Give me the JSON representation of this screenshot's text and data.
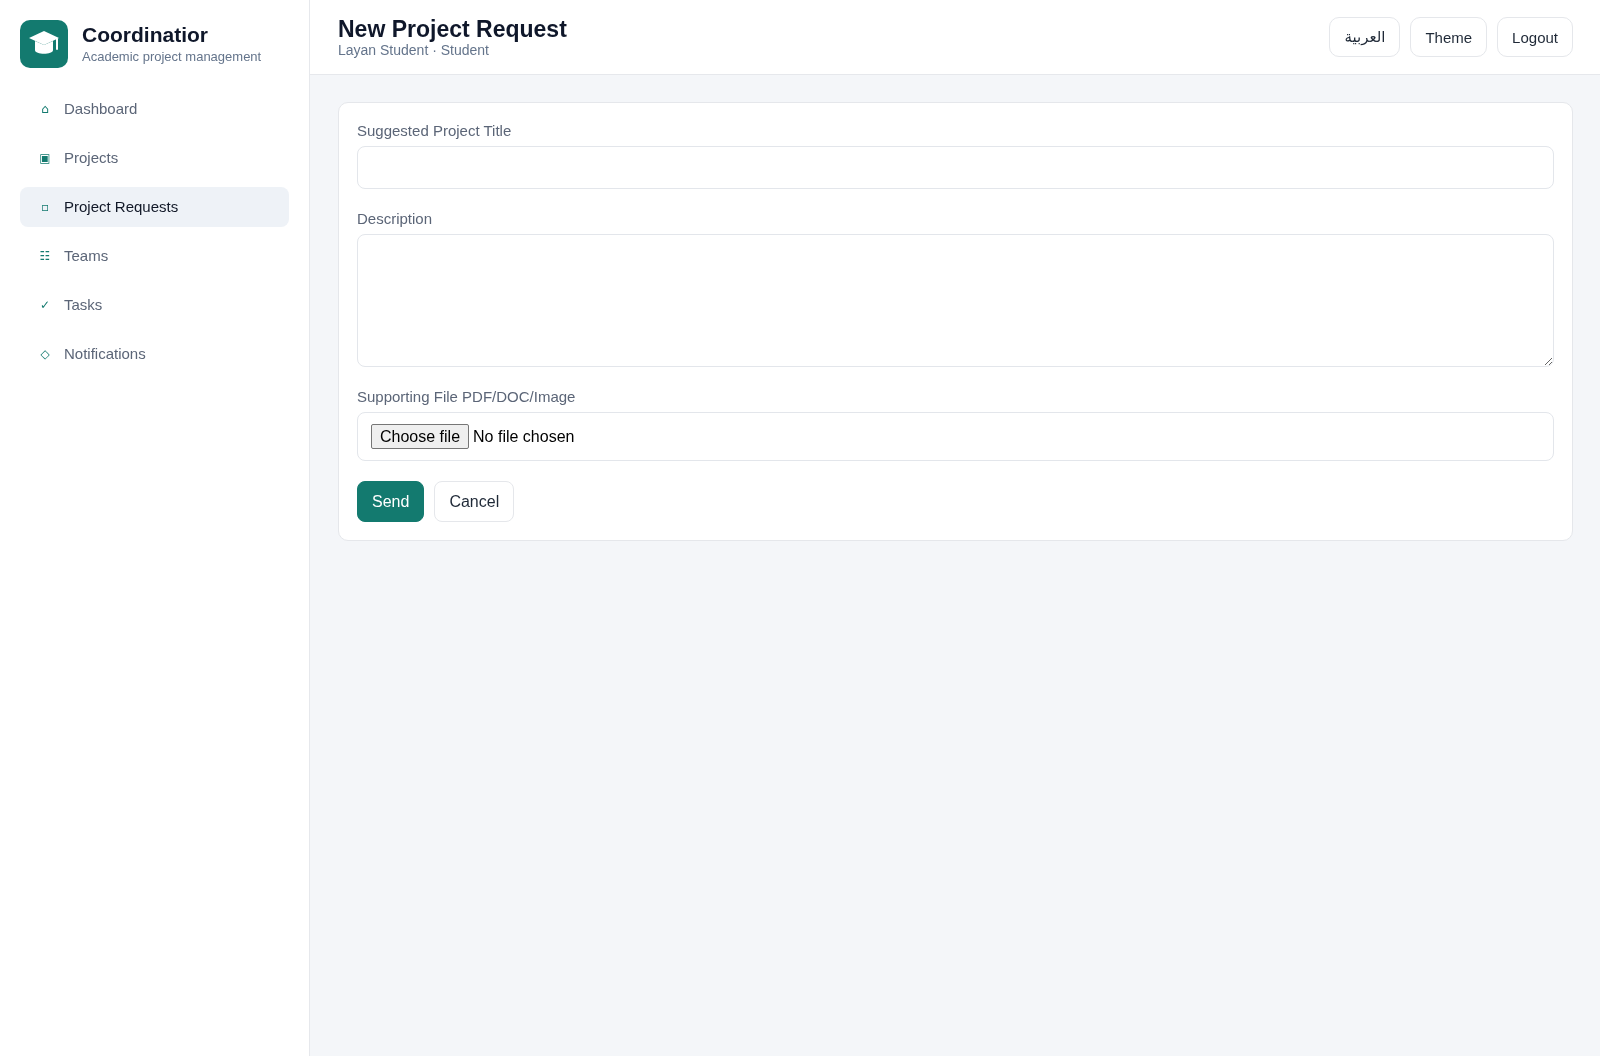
{
  "sidebar": {
    "brand": {
      "title": "Coordinatior",
      "subtitle": "Academic project management"
    },
    "items": [
      {
        "icon": "⌂",
        "label": "Dashboard",
        "selected": false
      },
      {
        "icon": "▣",
        "label": "Projects",
        "selected": false
      },
      {
        "icon": "▫",
        "label": "Project Requests",
        "selected": true
      },
      {
        "icon": "☷",
        "label": "Teams",
        "selected": false
      },
      {
        "icon": "✓",
        "label": "Tasks",
        "selected": false
      },
      {
        "icon": "◇",
        "label": "Notifications",
        "selected": false
      }
    ]
  },
  "header": {
    "title": "New Project Request",
    "subtitle": "Layan Student · Student",
    "buttons": [
      "العربية",
      "Theme",
      "Logout"
    ]
  },
  "form": {
    "fields": [
      {
        "kind": "text",
        "label": "Suggested Project Title"
      },
      {
        "kind": "textarea",
        "label": "Description"
      },
      {
        "kind": "file",
        "label": "Supporting File PDF/DOC/Image",
        "button": "Choose file",
        "status": "No file chosen"
      }
    ],
    "actions": [
      {
        "kind": "primary",
        "label": "Send"
      },
      {
        "kind": "secondary",
        "label": "Cancel"
      }
    ]
  }
}
